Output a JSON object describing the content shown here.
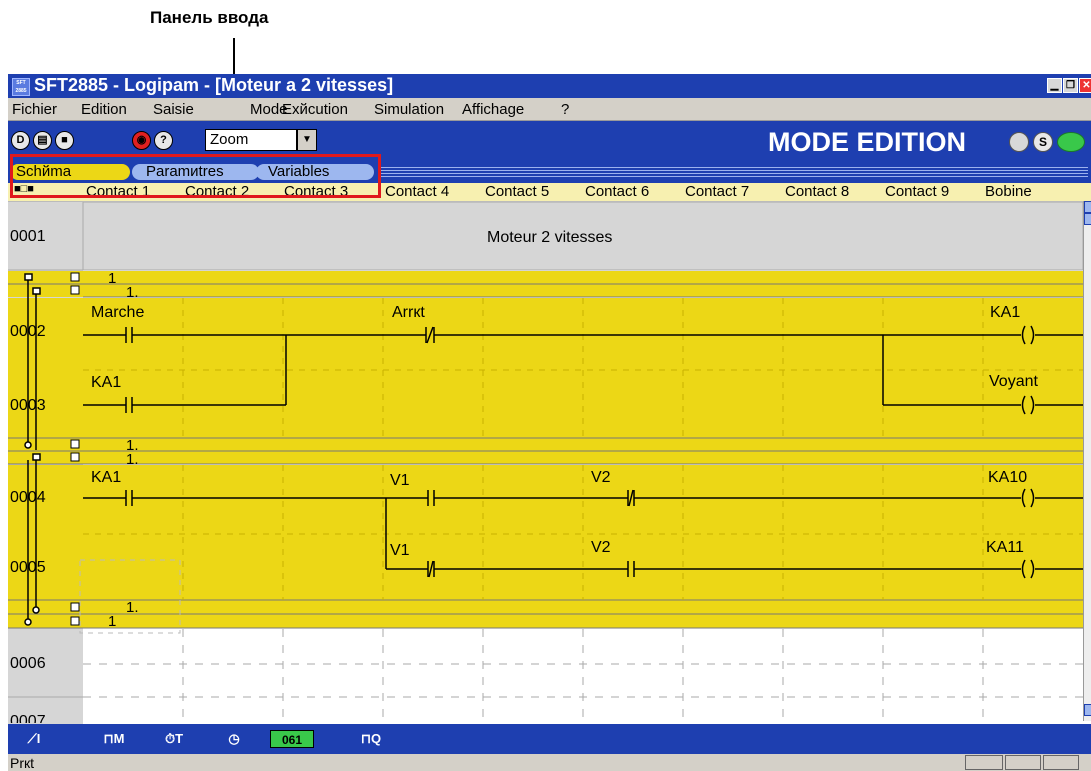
{
  "annotation": {
    "label": "Панель ввода"
  },
  "window": {
    "title": "SFT2885 - Logipam - [Moteur a 2 vitesses]",
    "icon_text": "SFT 2885",
    "controls": [
      "minimize-icon",
      "restore-icon",
      "close-icon"
    ]
  },
  "menu": {
    "items": [
      "Fichier",
      "Edition",
      "Saisie",
      "Mode",
      "Exйcution",
      "Simulation",
      "Affichage",
      "?"
    ]
  },
  "toolbar": {
    "zoom_value": "Zoom",
    "mode_label": "MODE EDITION",
    "mode_s": "S",
    "buttons": [
      "new-icon",
      "open-icon",
      "save-icon",
      "view-icon",
      "help-icon"
    ]
  },
  "tabs": [
    "Schйma",
    "Paramиtres",
    "Variables"
  ],
  "columns": [
    "Contact 1",
    "Contact 2",
    "Contact 3",
    "Contact 4",
    "Contact 5",
    "Contact 6",
    "Contact 7",
    "Contact 8",
    "Contact 9",
    "Bobine"
  ],
  "rungs": {
    "r0001": {
      "num": "0001",
      "comment": "Moteur 2 vitesses"
    },
    "r0002": {
      "num": "0002",
      "c1": "Marche",
      "c4": "Arrкt",
      "coil": "KA1"
    },
    "r0003": {
      "num": "0003",
      "c1": "KA1",
      "coil": "Voyant"
    },
    "r0004": {
      "num": "0004",
      "c1": "KA1",
      "c4": "V1",
      "c6": "V2",
      "coil": "KA10"
    },
    "r0005": {
      "num": "0005",
      "c4": "V1",
      "c6": "V2",
      "coil": "KA11"
    },
    "r0006": {
      "num": "0006"
    },
    "r0007": {
      "num": "0007"
    }
  },
  "block_markers": {
    "one": "1",
    "one_dot": "1."
  },
  "bottom_toolbar": {
    "counter": "061"
  },
  "status": {
    "text": "Prкt"
  },
  "colors": {
    "title_blue": "#1e3fb0",
    "rung_yellow": "#ecd716",
    "highlight_red": "#e0191d"
  }
}
